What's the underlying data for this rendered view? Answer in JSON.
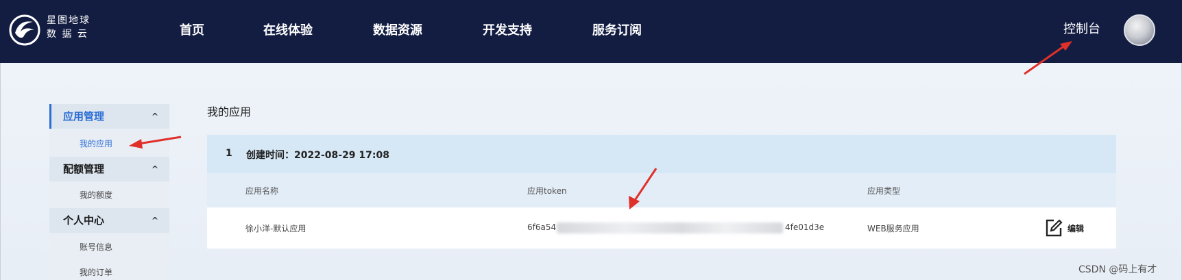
{
  "brand": {
    "line1": "星图地球",
    "line2": "数 据 云"
  },
  "nav": [
    "首页",
    "在线体验",
    "数据资源",
    "开发支持",
    "服务订阅"
  ],
  "header": {
    "console": "控制台"
  },
  "sidebar": {
    "groups": [
      {
        "label": "应用管理",
        "items": [
          "我的应用"
        ]
      },
      {
        "label": "配额管理",
        "items": [
          "我的额度"
        ]
      },
      {
        "label": "个人中心",
        "items": [
          "账号信息",
          "我的订单"
        ]
      }
    ]
  },
  "main": {
    "title": "我的应用",
    "app": {
      "index": "1",
      "created": "创建时间：2022-08-29 17:08",
      "columns": [
        "应用名称",
        "应用token",
        "应用类型"
      ],
      "row": {
        "name": "徐小洋-默认应用",
        "token_start": "6f6a54",
        "token_end": "4fe01d3e",
        "type": "WEB服务应用"
      },
      "edit_label": "编辑"
    }
  },
  "watermark": "CSDN @码上有才",
  "colors": {
    "topbar": "#131d42",
    "accent": "#2a6dd4",
    "arrow": "#e0302a"
  }
}
